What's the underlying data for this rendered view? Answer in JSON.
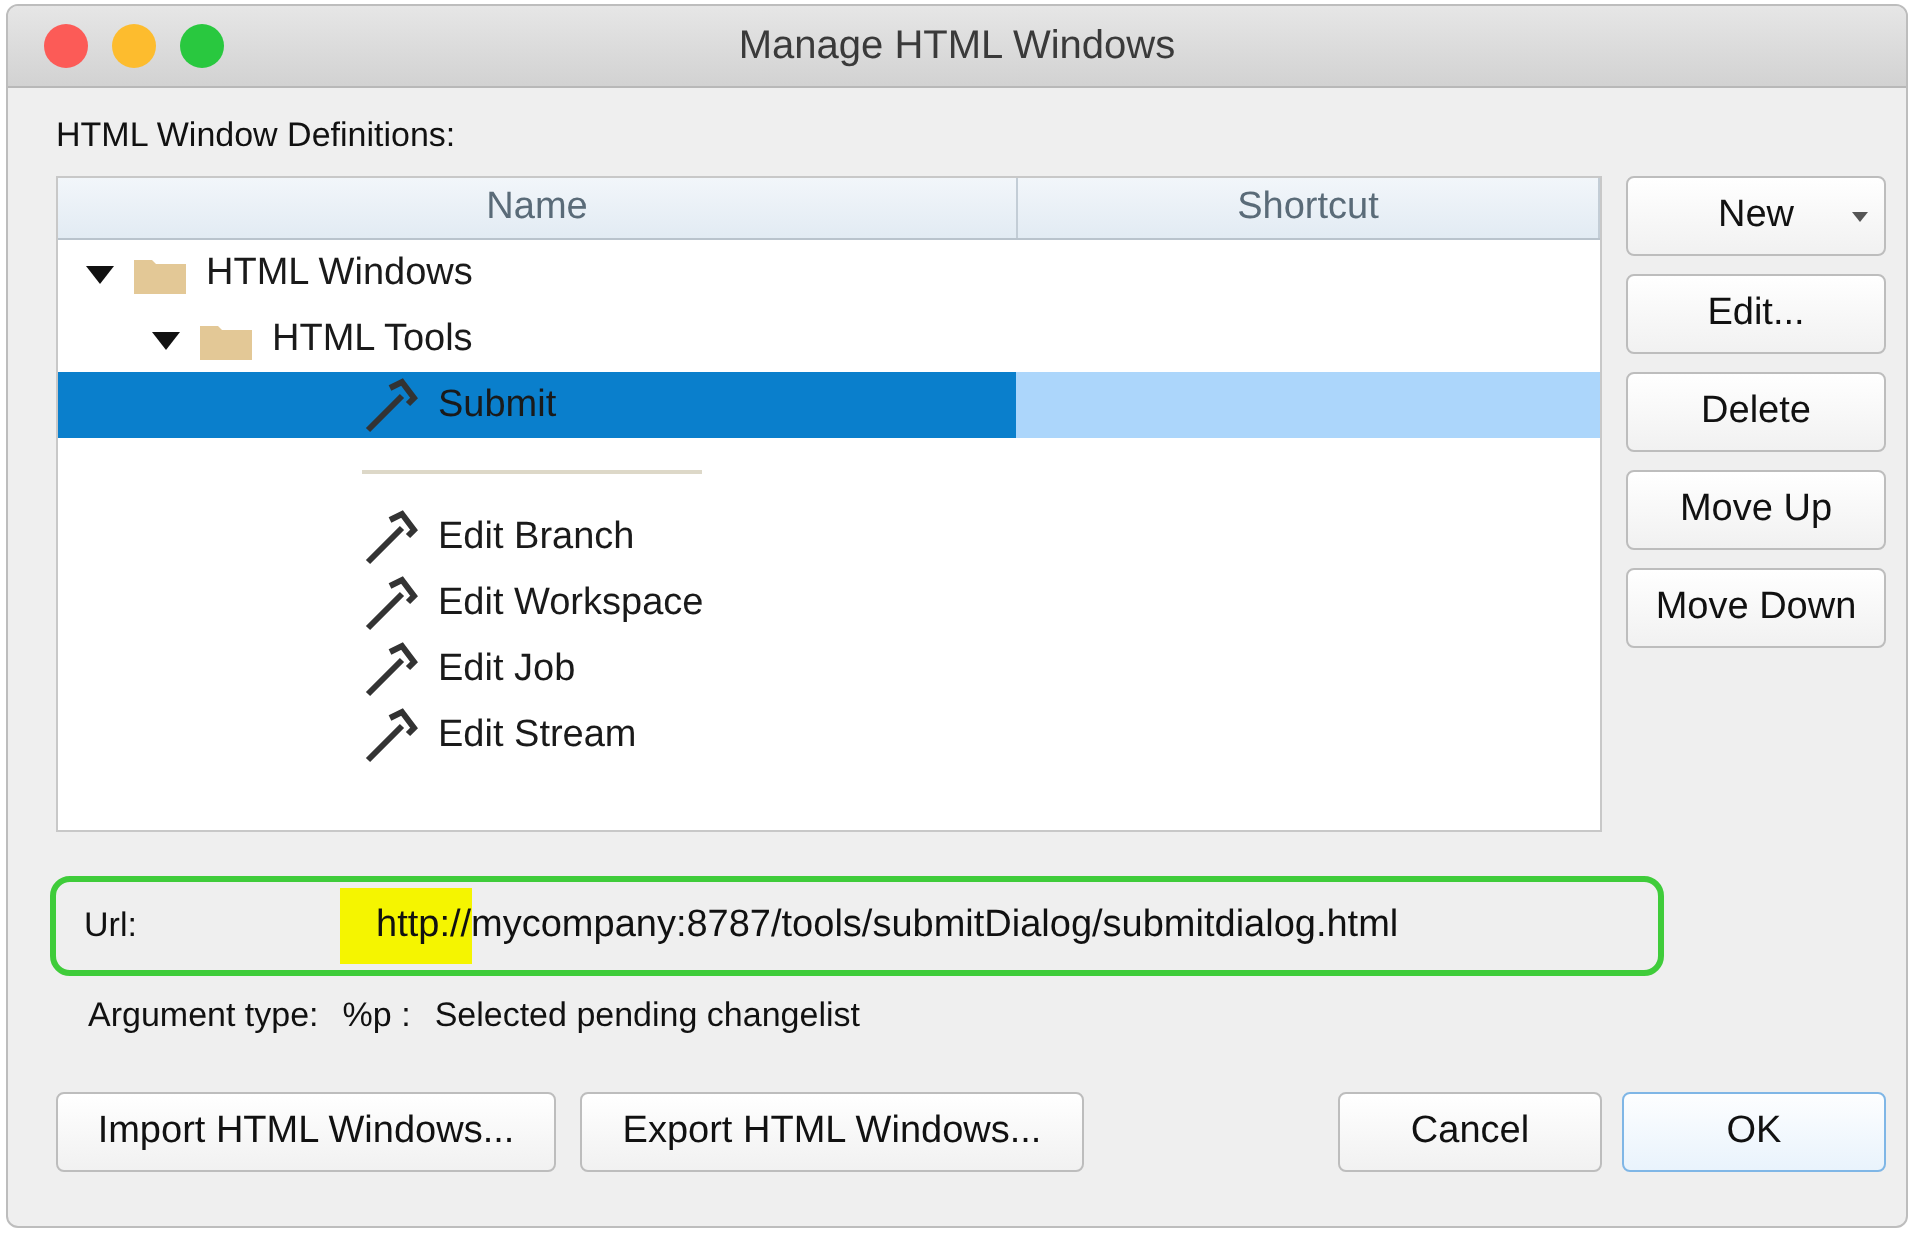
{
  "window": {
    "title": "Manage HTML Windows"
  },
  "section_label": "HTML Window Definitions:",
  "table": {
    "columns": [
      "Name",
      "Shortcut"
    ],
    "tree": [
      {
        "kind": "folder",
        "label": "HTML Windows",
        "expanded": true,
        "selected": false,
        "children": [
          {
            "kind": "folder",
            "label": "HTML Tools",
            "expanded": true,
            "selected": false,
            "children": [
              {
                "kind": "tool",
                "label": "Submit",
                "selected": true
              },
              {
                "kind": "separator"
              },
              {
                "kind": "tool",
                "label": "Edit Branch",
                "selected": false
              },
              {
                "kind": "tool",
                "label": "Edit Workspace",
                "selected": false
              },
              {
                "kind": "tool",
                "label": "Edit Job",
                "selected": false
              },
              {
                "kind": "tool",
                "label": "Edit Stream",
                "selected": false
              }
            ]
          }
        ]
      }
    ]
  },
  "side_buttons": [
    {
      "label": "New",
      "dropdown": true
    },
    {
      "label": "Edit...",
      "dropdown": false
    },
    {
      "label": "Delete",
      "dropdown": false
    },
    {
      "label": "Move Up",
      "dropdown": false
    },
    {
      "label": "Move Down",
      "dropdown": false
    }
  ],
  "url": {
    "label": "Url:",
    "highlighted_part": "http://",
    "rest": "mycompany:8787/tools/submitDialog/submitdialog.html",
    "outlined": true
  },
  "argument": {
    "label": "Argument type:",
    "code": "%p :",
    "description": "Selected pending changelist"
  },
  "bottom_left_buttons": [
    "Import HTML Windows...",
    "Export HTML Windows..."
  ],
  "bottom_right_buttons": [
    {
      "label": "Cancel",
      "default": false
    },
    {
      "label": "OK",
      "default": true
    }
  ]
}
